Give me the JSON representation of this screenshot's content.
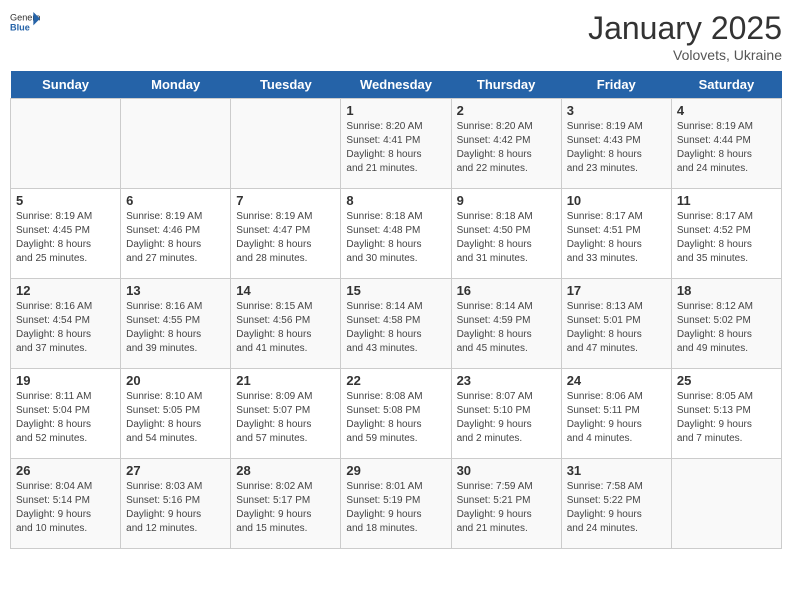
{
  "header": {
    "logo": {
      "general": "General",
      "blue": "Blue"
    },
    "title": "January 2025",
    "subtitle": "Volovets, Ukraine"
  },
  "days": [
    "Sunday",
    "Monday",
    "Tuesday",
    "Wednesday",
    "Thursday",
    "Friday",
    "Saturday"
  ],
  "weeks": [
    [
      {
        "date": "",
        "info": ""
      },
      {
        "date": "",
        "info": ""
      },
      {
        "date": "",
        "info": ""
      },
      {
        "date": "1",
        "info": "Sunrise: 8:20 AM\nSunset: 4:41 PM\nDaylight: 8 hours\nand 21 minutes."
      },
      {
        "date": "2",
        "info": "Sunrise: 8:20 AM\nSunset: 4:42 PM\nDaylight: 8 hours\nand 22 minutes."
      },
      {
        "date": "3",
        "info": "Sunrise: 8:19 AM\nSunset: 4:43 PM\nDaylight: 8 hours\nand 23 minutes."
      },
      {
        "date": "4",
        "info": "Sunrise: 8:19 AM\nSunset: 4:44 PM\nDaylight: 8 hours\nand 24 minutes."
      }
    ],
    [
      {
        "date": "5",
        "info": "Sunrise: 8:19 AM\nSunset: 4:45 PM\nDaylight: 8 hours\nand 25 minutes."
      },
      {
        "date": "6",
        "info": "Sunrise: 8:19 AM\nSunset: 4:46 PM\nDaylight: 8 hours\nand 27 minutes."
      },
      {
        "date": "7",
        "info": "Sunrise: 8:19 AM\nSunset: 4:47 PM\nDaylight: 8 hours\nand 28 minutes."
      },
      {
        "date": "8",
        "info": "Sunrise: 8:18 AM\nSunset: 4:48 PM\nDaylight: 8 hours\nand 30 minutes."
      },
      {
        "date": "9",
        "info": "Sunrise: 8:18 AM\nSunset: 4:50 PM\nDaylight: 8 hours\nand 31 minutes."
      },
      {
        "date": "10",
        "info": "Sunrise: 8:17 AM\nSunset: 4:51 PM\nDaylight: 8 hours\nand 33 minutes."
      },
      {
        "date": "11",
        "info": "Sunrise: 8:17 AM\nSunset: 4:52 PM\nDaylight: 8 hours\nand 35 minutes."
      }
    ],
    [
      {
        "date": "12",
        "info": "Sunrise: 8:16 AM\nSunset: 4:54 PM\nDaylight: 8 hours\nand 37 minutes."
      },
      {
        "date": "13",
        "info": "Sunrise: 8:16 AM\nSunset: 4:55 PM\nDaylight: 8 hours\nand 39 minutes."
      },
      {
        "date": "14",
        "info": "Sunrise: 8:15 AM\nSunset: 4:56 PM\nDaylight: 8 hours\nand 41 minutes."
      },
      {
        "date": "15",
        "info": "Sunrise: 8:14 AM\nSunset: 4:58 PM\nDaylight: 8 hours\nand 43 minutes."
      },
      {
        "date": "16",
        "info": "Sunrise: 8:14 AM\nSunset: 4:59 PM\nDaylight: 8 hours\nand 45 minutes."
      },
      {
        "date": "17",
        "info": "Sunrise: 8:13 AM\nSunset: 5:01 PM\nDaylight: 8 hours\nand 47 minutes."
      },
      {
        "date": "18",
        "info": "Sunrise: 8:12 AM\nSunset: 5:02 PM\nDaylight: 8 hours\nand 49 minutes."
      }
    ],
    [
      {
        "date": "19",
        "info": "Sunrise: 8:11 AM\nSunset: 5:04 PM\nDaylight: 8 hours\nand 52 minutes."
      },
      {
        "date": "20",
        "info": "Sunrise: 8:10 AM\nSunset: 5:05 PM\nDaylight: 8 hours\nand 54 minutes."
      },
      {
        "date": "21",
        "info": "Sunrise: 8:09 AM\nSunset: 5:07 PM\nDaylight: 8 hours\nand 57 minutes."
      },
      {
        "date": "22",
        "info": "Sunrise: 8:08 AM\nSunset: 5:08 PM\nDaylight: 8 hours\nand 59 minutes."
      },
      {
        "date": "23",
        "info": "Sunrise: 8:07 AM\nSunset: 5:10 PM\nDaylight: 9 hours\nand 2 minutes."
      },
      {
        "date": "24",
        "info": "Sunrise: 8:06 AM\nSunset: 5:11 PM\nDaylight: 9 hours\nand 4 minutes."
      },
      {
        "date": "25",
        "info": "Sunrise: 8:05 AM\nSunset: 5:13 PM\nDaylight: 9 hours\nand 7 minutes."
      }
    ],
    [
      {
        "date": "26",
        "info": "Sunrise: 8:04 AM\nSunset: 5:14 PM\nDaylight: 9 hours\nand 10 minutes."
      },
      {
        "date": "27",
        "info": "Sunrise: 8:03 AM\nSunset: 5:16 PM\nDaylight: 9 hours\nand 12 minutes."
      },
      {
        "date": "28",
        "info": "Sunrise: 8:02 AM\nSunset: 5:17 PM\nDaylight: 9 hours\nand 15 minutes."
      },
      {
        "date": "29",
        "info": "Sunrise: 8:01 AM\nSunset: 5:19 PM\nDaylight: 9 hours\nand 18 minutes."
      },
      {
        "date": "30",
        "info": "Sunrise: 7:59 AM\nSunset: 5:21 PM\nDaylight: 9 hours\nand 21 minutes."
      },
      {
        "date": "31",
        "info": "Sunrise: 7:58 AM\nSunset: 5:22 PM\nDaylight: 9 hours\nand 24 minutes."
      },
      {
        "date": "",
        "info": ""
      }
    ]
  ]
}
